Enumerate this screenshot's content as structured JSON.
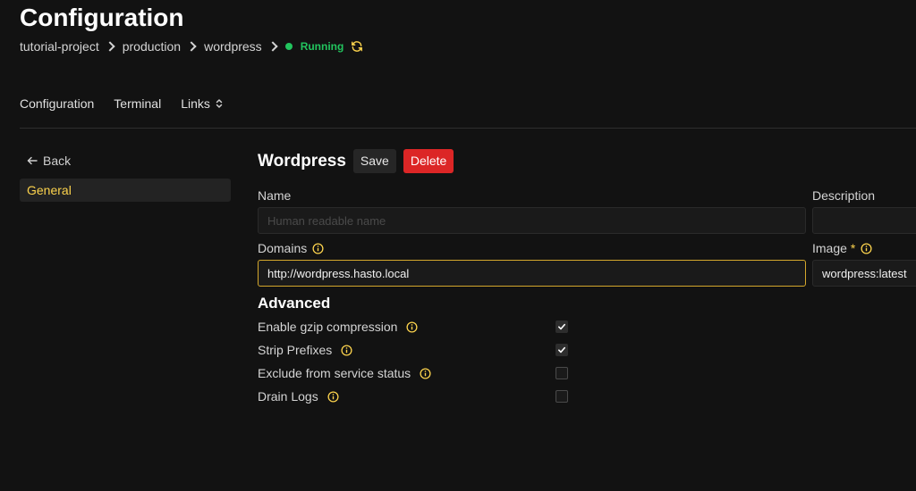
{
  "header": {
    "title": "Configuration",
    "breadcrumb": [
      "tutorial-project",
      "production",
      "wordpress"
    ],
    "status": "Running"
  },
  "tabs": [
    {
      "label": "Configuration"
    },
    {
      "label": "Terminal"
    },
    {
      "label": "Links"
    }
  ],
  "sidebar": {
    "back_label": "Back",
    "items": [
      {
        "label": "General",
        "active": true
      }
    ]
  },
  "service": {
    "name": "Wordpress",
    "save_label": "Save",
    "delete_label": "Delete"
  },
  "fields": {
    "name": {
      "label": "Name",
      "value": "",
      "placeholder": "Human readable name"
    },
    "description": {
      "label": "Description",
      "value": ""
    },
    "domains": {
      "label": "Domains",
      "value": "http://wordpress.hasto.local"
    },
    "image": {
      "label": "Image",
      "required_mark": "*",
      "value": "wordpress:latest"
    }
  },
  "advanced": {
    "title": "Advanced",
    "options": [
      {
        "label": "Enable gzip compression",
        "checked": true
      },
      {
        "label": "Strip Prefixes",
        "checked": true
      },
      {
        "label": "Exclude from service status",
        "checked": false
      },
      {
        "label": "Drain Logs",
        "checked": false
      }
    ]
  },
  "colors": {
    "accent": "#fcd34d",
    "status_green": "#22c55e",
    "danger": "#dc2626",
    "background": "#121212"
  },
  "icons": {
    "breadcrumb_separator": "chevron-right-icon",
    "status": "status-dot-icon",
    "refresh": "refresh-icon",
    "links_toggle": "chevron-updown-icon",
    "back": "arrow-left-icon",
    "info": "info-icon",
    "checkbox": "check-icon"
  }
}
